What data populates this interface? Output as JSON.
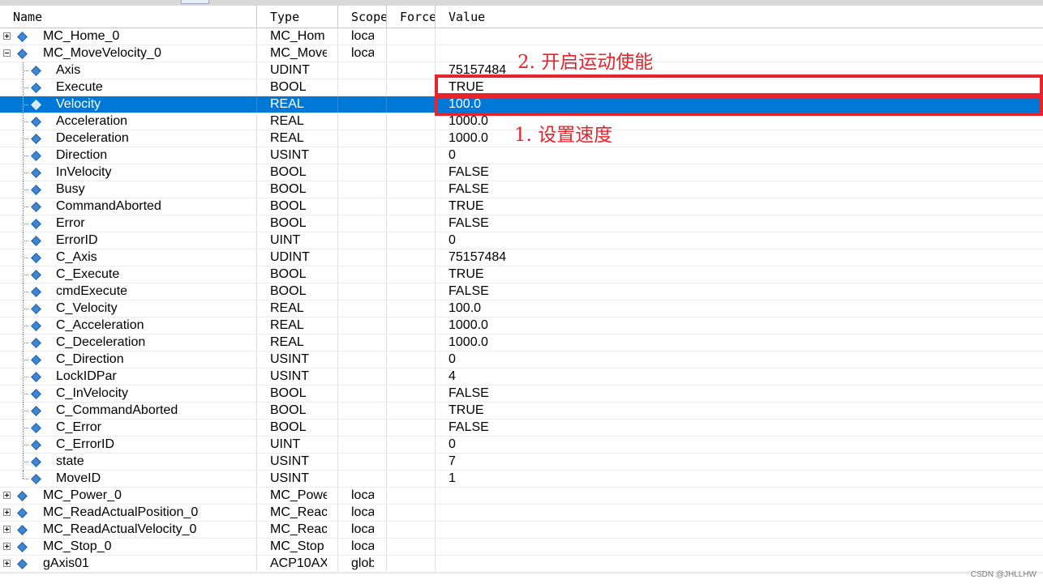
{
  "columns": {
    "name": "Name",
    "type": "Type",
    "scope": "Scope",
    "force": "Force",
    "value": "Value"
  },
  "rows": [
    {
      "name": "MC_Home_0",
      "type": "MC_Hom",
      "scope": "loca",
      "value": "",
      "level": 0,
      "expander": "plus"
    },
    {
      "name": "MC_MoveVelocity_0",
      "type": "MC_Move",
      "scope": "loca",
      "value": "",
      "level": 0,
      "expander": "minus"
    },
    {
      "name": "Axis",
      "type": "UDINT",
      "scope": "",
      "value": "75157484",
      "level": 1
    },
    {
      "name": "Execute",
      "type": "BOOL",
      "scope": "",
      "value": "TRUE",
      "level": 1
    },
    {
      "name": "Velocity",
      "type": "REAL",
      "scope": "",
      "value": "100.0",
      "level": 1,
      "selected": true
    },
    {
      "name": "Acceleration",
      "type": "REAL",
      "scope": "",
      "value": "1000.0",
      "level": 1
    },
    {
      "name": "Deceleration",
      "type": "REAL",
      "scope": "",
      "value": "1000.0",
      "level": 1
    },
    {
      "name": "Direction",
      "type": "USINT",
      "scope": "",
      "value": "0",
      "level": 1
    },
    {
      "name": "InVelocity",
      "type": "BOOL",
      "scope": "",
      "value": "FALSE",
      "level": 1
    },
    {
      "name": "Busy",
      "type": "BOOL",
      "scope": "",
      "value": "FALSE",
      "level": 1
    },
    {
      "name": "CommandAborted",
      "type": "BOOL",
      "scope": "",
      "value": "TRUE",
      "level": 1
    },
    {
      "name": "Error",
      "type": "BOOL",
      "scope": "",
      "value": "FALSE",
      "level": 1
    },
    {
      "name": "ErrorID",
      "type": "UINT",
      "scope": "",
      "value": "0",
      "level": 1
    },
    {
      "name": "C_Axis",
      "type": "UDINT",
      "scope": "",
      "value": "75157484",
      "level": 1
    },
    {
      "name": "C_Execute",
      "type": "BOOL",
      "scope": "",
      "value": "TRUE",
      "level": 1
    },
    {
      "name": "cmdExecute",
      "type": "BOOL",
      "scope": "",
      "value": "FALSE",
      "level": 1
    },
    {
      "name": "C_Velocity",
      "type": "REAL",
      "scope": "",
      "value": "100.0",
      "level": 1
    },
    {
      "name": "C_Acceleration",
      "type": "REAL",
      "scope": "",
      "value": "1000.0",
      "level": 1
    },
    {
      "name": "C_Deceleration",
      "type": "REAL",
      "scope": "",
      "value": "1000.0",
      "level": 1
    },
    {
      "name": "C_Direction",
      "type": "USINT",
      "scope": "",
      "value": "0",
      "level": 1
    },
    {
      "name": "LockIDPar",
      "type": "USINT",
      "scope": "",
      "value": "4",
      "level": 1
    },
    {
      "name": "C_InVelocity",
      "type": "BOOL",
      "scope": "",
      "value": "FALSE",
      "level": 1
    },
    {
      "name": "C_CommandAborted",
      "type": "BOOL",
      "scope": "",
      "value": "TRUE",
      "level": 1
    },
    {
      "name": "C_Error",
      "type": "BOOL",
      "scope": "",
      "value": "FALSE",
      "level": 1
    },
    {
      "name": "C_ErrorID",
      "type": "UINT",
      "scope": "",
      "value": "0",
      "level": 1
    },
    {
      "name": "state",
      "type": "USINT",
      "scope": "",
      "value": "7",
      "level": 1
    },
    {
      "name": "MoveID",
      "type": "USINT",
      "scope": "",
      "value": "1",
      "level": 1,
      "last": true
    },
    {
      "name": "MC_Power_0",
      "type": "MC_Powe",
      "scope": "loca",
      "value": "",
      "level": 0,
      "expander": "plus"
    },
    {
      "name": "MC_ReadActualPosition_0",
      "type": "MC_Reac",
      "scope": "loca",
      "value": "",
      "level": 0,
      "expander": "plus"
    },
    {
      "name": "MC_ReadActualVelocity_0",
      "type": "MC_Reac",
      "scope": "loca",
      "value": "",
      "level": 0,
      "expander": "plus"
    },
    {
      "name": "MC_Stop_0",
      "type": "MC_Stop",
      "scope": "loca",
      "value": "",
      "level": 0,
      "expander": "plus"
    },
    {
      "name": "gAxis01",
      "type": "ACP10AX",
      "scope": "glob",
      "value": "",
      "level": 0,
      "expander": "plus"
    }
  ],
  "annotations": {
    "step2": "2. 开启运动使能",
    "step1": "1. 设置速度"
  },
  "watermark": "CSDN @JHLLHW",
  "colors": {
    "selection": "#0078d7",
    "annotation": "#e8232b",
    "icon": "#3d86d6"
  },
  "icons": {
    "variable": "diamond-variable-icon",
    "expand": "plus-box-icon",
    "collapse": "minus-box-icon"
  }
}
